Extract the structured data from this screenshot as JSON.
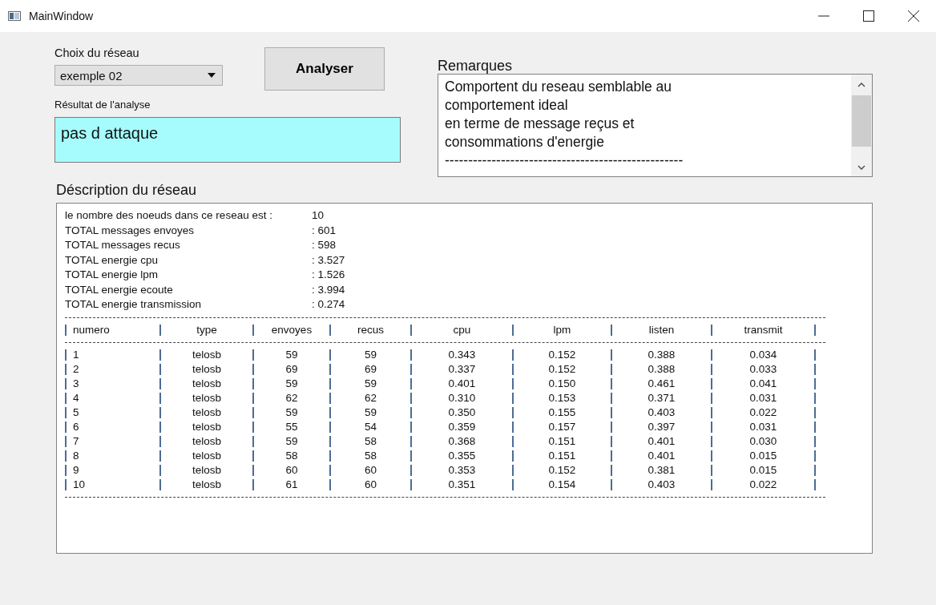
{
  "window": {
    "title": "MainWindow"
  },
  "network": {
    "label": "Choix du réseau",
    "value": "exemple 02"
  },
  "analyse_button": "Analyser",
  "result": {
    "label": "Résultat de l'analyse",
    "value": "pas d attaque"
  },
  "remarks": {
    "label": "Remarques",
    "lines": [
      "Comportent du reseau semblable au",
      "comportement ideal",
      "en terme de message reçus et",
      "consommations d'energie",
      "---------------------------------------------------"
    ]
  },
  "description": {
    "label": "Déscription du réseau",
    "summary": [
      {
        "label": "le nombre des noeuds dans ce reseau est :",
        "value": "10"
      },
      {
        "label": "TOTAL messages envoyes",
        "value": ":  601"
      },
      {
        "label": "TOTAL messages recus",
        "value": ":  598"
      },
      {
        "label": "TOTAL energie cpu",
        "value": ":  3.527"
      },
      {
        "label": "TOTAL energie lpm",
        "value": ":  1.526"
      },
      {
        "label": "TOTAL energie ecoute",
        "value": ":  3.994"
      },
      {
        "label": "TOTAL energie transmission",
        "value": ":  0.274"
      }
    ],
    "table": {
      "columns": [
        "numero",
        "type",
        "envoyes",
        "recus",
        "cpu",
        "lpm",
        "listen",
        "transmit"
      ],
      "rows": [
        [
          "1",
          "telosb",
          "59",
          "59",
          "0.343",
          "0.152",
          "0.388",
          "0.034"
        ],
        [
          "2",
          "telosb",
          "69",
          "69",
          "0.337",
          "0.152",
          "0.388",
          "0.033"
        ],
        [
          "3",
          "telosb",
          "59",
          "59",
          "0.401",
          "0.150",
          "0.461",
          "0.041"
        ],
        [
          "4",
          "telosb",
          "62",
          "62",
          "0.310",
          "0.153",
          "0.371",
          "0.031"
        ],
        [
          "5",
          "telosb",
          "59",
          "59",
          "0.350",
          "0.155",
          "0.403",
          "0.022"
        ],
        [
          "6",
          "telosb",
          "55",
          "54",
          "0.359",
          "0.157",
          "0.397",
          "0.031"
        ],
        [
          "7",
          "telosb",
          "59",
          "58",
          "0.368",
          "0.151",
          "0.401",
          "0.030"
        ],
        [
          "8",
          "telosb",
          "58",
          "58",
          "0.355",
          "0.151",
          "0.401",
          "0.015"
        ],
        [
          "9",
          "telosb",
          "60",
          "60",
          "0.353",
          "0.152",
          "0.381",
          "0.015"
        ],
        [
          "10",
          "telosb",
          "61",
          "60",
          "0.351",
          "0.154",
          "0.403",
          "0.022"
        ]
      ]
    }
  }
}
